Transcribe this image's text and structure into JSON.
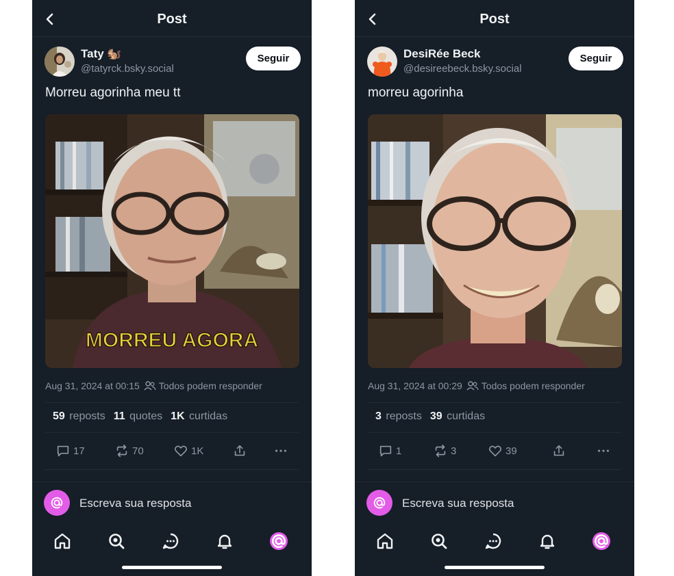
{
  "posts": [
    {
      "header_title": "Post",
      "author_name": "Taty 🐿️",
      "author_handle": "@tatyrck.bsky.social",
      "follow_label": "Seguir",
      "text": "Morreu agorinha meu tt",
      "media_caption": "MORREU AGORA",
      "timestamp": "Aug 31, 2024 at 00:15",
      "reply_permission": "Todos podem responder",
      "stats": {
        "reposts_count": "59",
        "reposts_label": "reposts",
        "quotes_count": "11",
        "quotes_label": "quotes",
        "likes_count": "1K",
        "likes_label": "curtidas"
      },
      "actions": {
        "replies": "17",
        "reposts": "70",
        "likes": "1K"
      },
      "reply_placeholder": "Escreva sua resposta"
    },
    {
      "header_title": "Post",
      "author_name": "DesiRée Beck",
      "author_handle": "@desireebeck.bsky.social",
      "follow_label": "Seguir",
      "text": "morreu agorinha",
      "timestamp": "Aug 31, 2024 at 00:29",
      "reply_permission": "Todos podem responder",
      "stats": {
        "reposts_count": "3",
        "reposts_label": "reposts",
        "likes_count": "39",
        "likes_label": "curtidas"
      },
      "actions": {
        "replies": "1",
        "reposts": "3",
        "likes": "39"
      },
      "reply_placeholder": "Escreva sua resposta"
    }
  ],
  "colors": {
    "background": "#161e27",
    "text": "#f1f3f5",
    "muted": "#8d98a5",
    "accent_avatar": "#e35ce8",
    "caption": "#e6d23a"
  },
  "icons": {
    "back": "chevron-left-icon",
    "people": "people-icon",
    "reply": "comment-icon",
    "repost": "repost-icon",
    "like": "heart-icon",
    "share": "share-icon",
    "more": "ellipsis-icon",
    "home": "home-icon",
    "search": "search-icon",
    "chat": "chat-icon",
    "notifications": "bell-icon",
    "profile": "at-sign-icon"
  }
}
